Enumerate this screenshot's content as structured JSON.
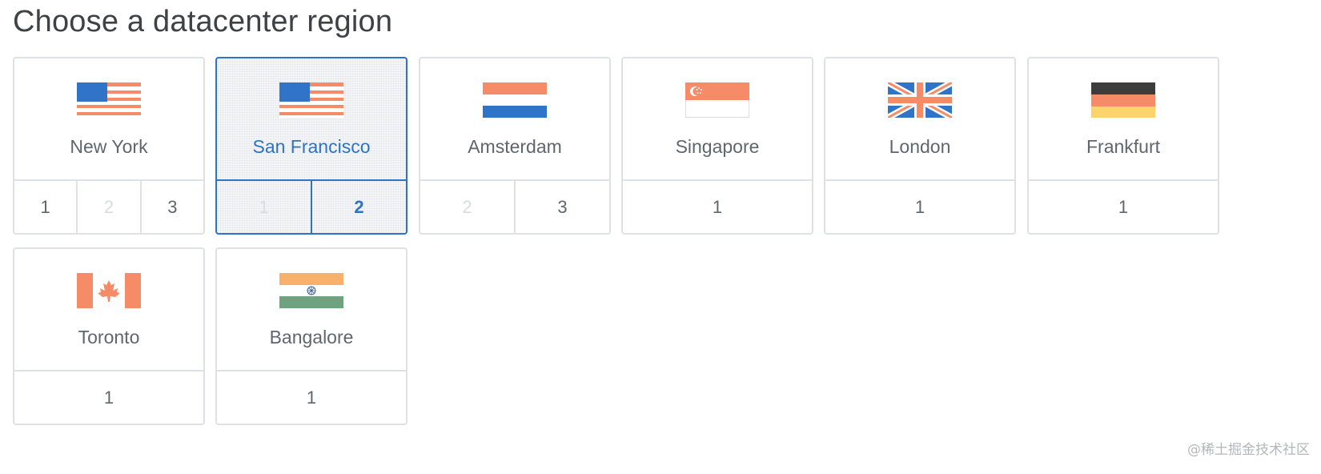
{
  "page": {
    "title": "Choose a datacenter region"
  },
  "regions": [
    {
      "name": "New York",
      "flag": "usa-flag-icon",
      "options": [
        {
          "label": "1",
          "state": "normal"
        },
        {
          "label": "2",
          "state": "disabled"
        },
        {
          "label": "3",
          "state": "normal"
        }
      ]
    },
    {
      "name": "San Francisco",
      "flag": "usa-flag-icon",
      "selected": true,
      "options": [
        {
          "label": "1",
          "state": "disabled"
        },
        {
          "label": "2",
          "state": "active"
        }
      ]
    },
    {
      "name": "Amsterdam",
      "flag": "netherlands-flag-icon",
      "options": [
        {
          "label": "2",
          "state": "disabled"
        },
        {
          "label": "3",
          "state": "normal"
        }
      ]
    },
    {
      "name": "Singapore",
      "flag": "singapore-flag-icon",
      "options": [
        {
          "label": "1",
          "state": "normal"
        }
      ]
    },
    {
      "name": "London",
      "flag": "uk-flag-icon",
      "options": [
        {
          "label": "1",
          "state": "normal"
        }
      ]
    },
    {
      "name": "Frankfurt",
      "flag": "germany-flag-icon",
      "options": [
        {
          "label": "1",
          "state": "normal"
        }
      ]
    },
    {
      "name": "Toronto",
      "flag": "canada-flag-icon",
      "options": [
        {
          "label": "1",
          "state": "normal"
        }
      ]
    },
    {
      "name": "Bangalore",
      "flag": "india-flag-icon",
      "options": [
        {
          "label": "1",
          "state": "normal"
        }
      ]
    }
  ],
  "colors": {
    "accent": "#2d73c6",
    "border": "#dfe2e5",
    "text": "#5e666e",
    "disabled_text": "#d9dcdf",
    "flag_orange": "#f58b67",
    "flag_blue": "#2f74c8"
  },
  "watermark": "@稀土掘金技术社区"
}
